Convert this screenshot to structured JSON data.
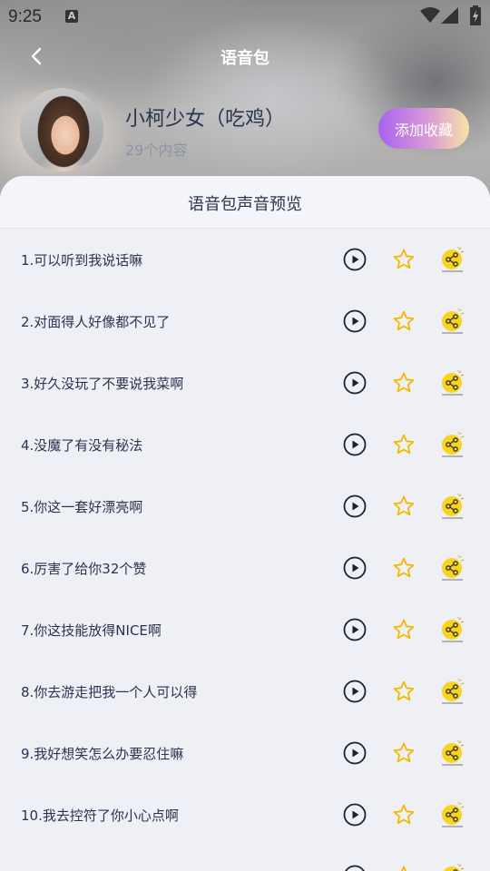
{
  "status": {
    "time": "9:25",
    "a_icon": "A"
  },
  "topbar": {
    "title": "语音包",
    "back_icon": "chevron-left-icon"
  },
  "pack": {
    "name": "小柯少女（吃鸡）",
    "count": "29个内容",
    "fav_label": "添加收藏"
  },
  "colors": {
    "accent_start": "#a962f0",
    "accent_end": "#f6e3a4",
    "star": "#f5b800",
    "share_bg": "#f7d51f"
  },
  "sheet": {
    "title": "语音包声音预览"
  },
  "items": [
    {
      "label": "1.可以听到我说话嘛"
    },
    {
      "label": "2.对面得人好像都不见了"
    },
    {
      "label": "3.好久没玩了不要说我菜啊"
    },
    {
      "label": "4.没魔了有没有秘法"
    },
    {
      "label": "5.你这一套好漂亮啊"
    },
    {
      "label": "6.厉害了给你32个赞"
    },
    {
      "label": "7.你这技能放得NICE啊"
    },
    {
      "label": "8.你去游走把我一个人可以得"
    },
    {
      "label": "9.我好想笑怎么办要忍住嘛"
    },
    {
      "label": "10.我去控符了你小心点啊"
    },
    {
      "label": ""
    }
  ]
}
